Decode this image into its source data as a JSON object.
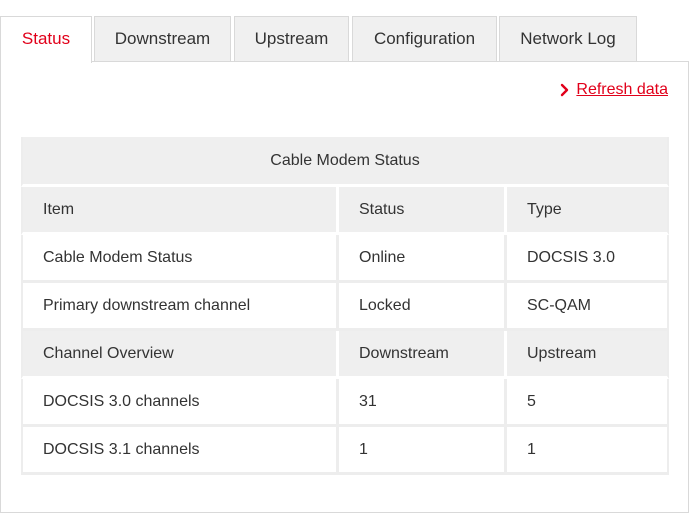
{
  "tabs": [
    {
      "label": "Status",
      "active": true
    },
    {
      "label": "Downstream",
      "active": false
    },
    {
      "label": "Upstream",
      "active": false
    },
    {
      "label": "Configuration",
      "active": false
    },
    {
      "label": "Network Log",
      "active": false
    }
  ],
  "refresh": {
    "icon": "chevron-right-icon",
    "label": "Refresh data"
  },
  "table": {
    "caption": "Cable Modem Status",
    "header": [
      "Item",
      "Status",
      "Type"
    ],
    "rows": [
      [
        "Cable Modem Status",
        "Online",
        "DOCSIS 3.0"
      ],
      [
        "Primary downstream channel",
        "Locked",
        "SC-QAM"
      ]
    ],
    "subheader": [
      "Channel Overview",
      "Downstream",
      "Upstream"
    ],
    "subrows": [
      [
        "DOCSIS 3.0 channels",
        "31",
        "5"
      ],
      [
        "DOCSIS 3.1 channels",
        "1",
        "1"
      ]
    ]
  },
  "colors": {
    "accent": "#e1001a",
    "header_bg": "#efefef",
    "tab_bg": "#f0f0f0"
  }
}
